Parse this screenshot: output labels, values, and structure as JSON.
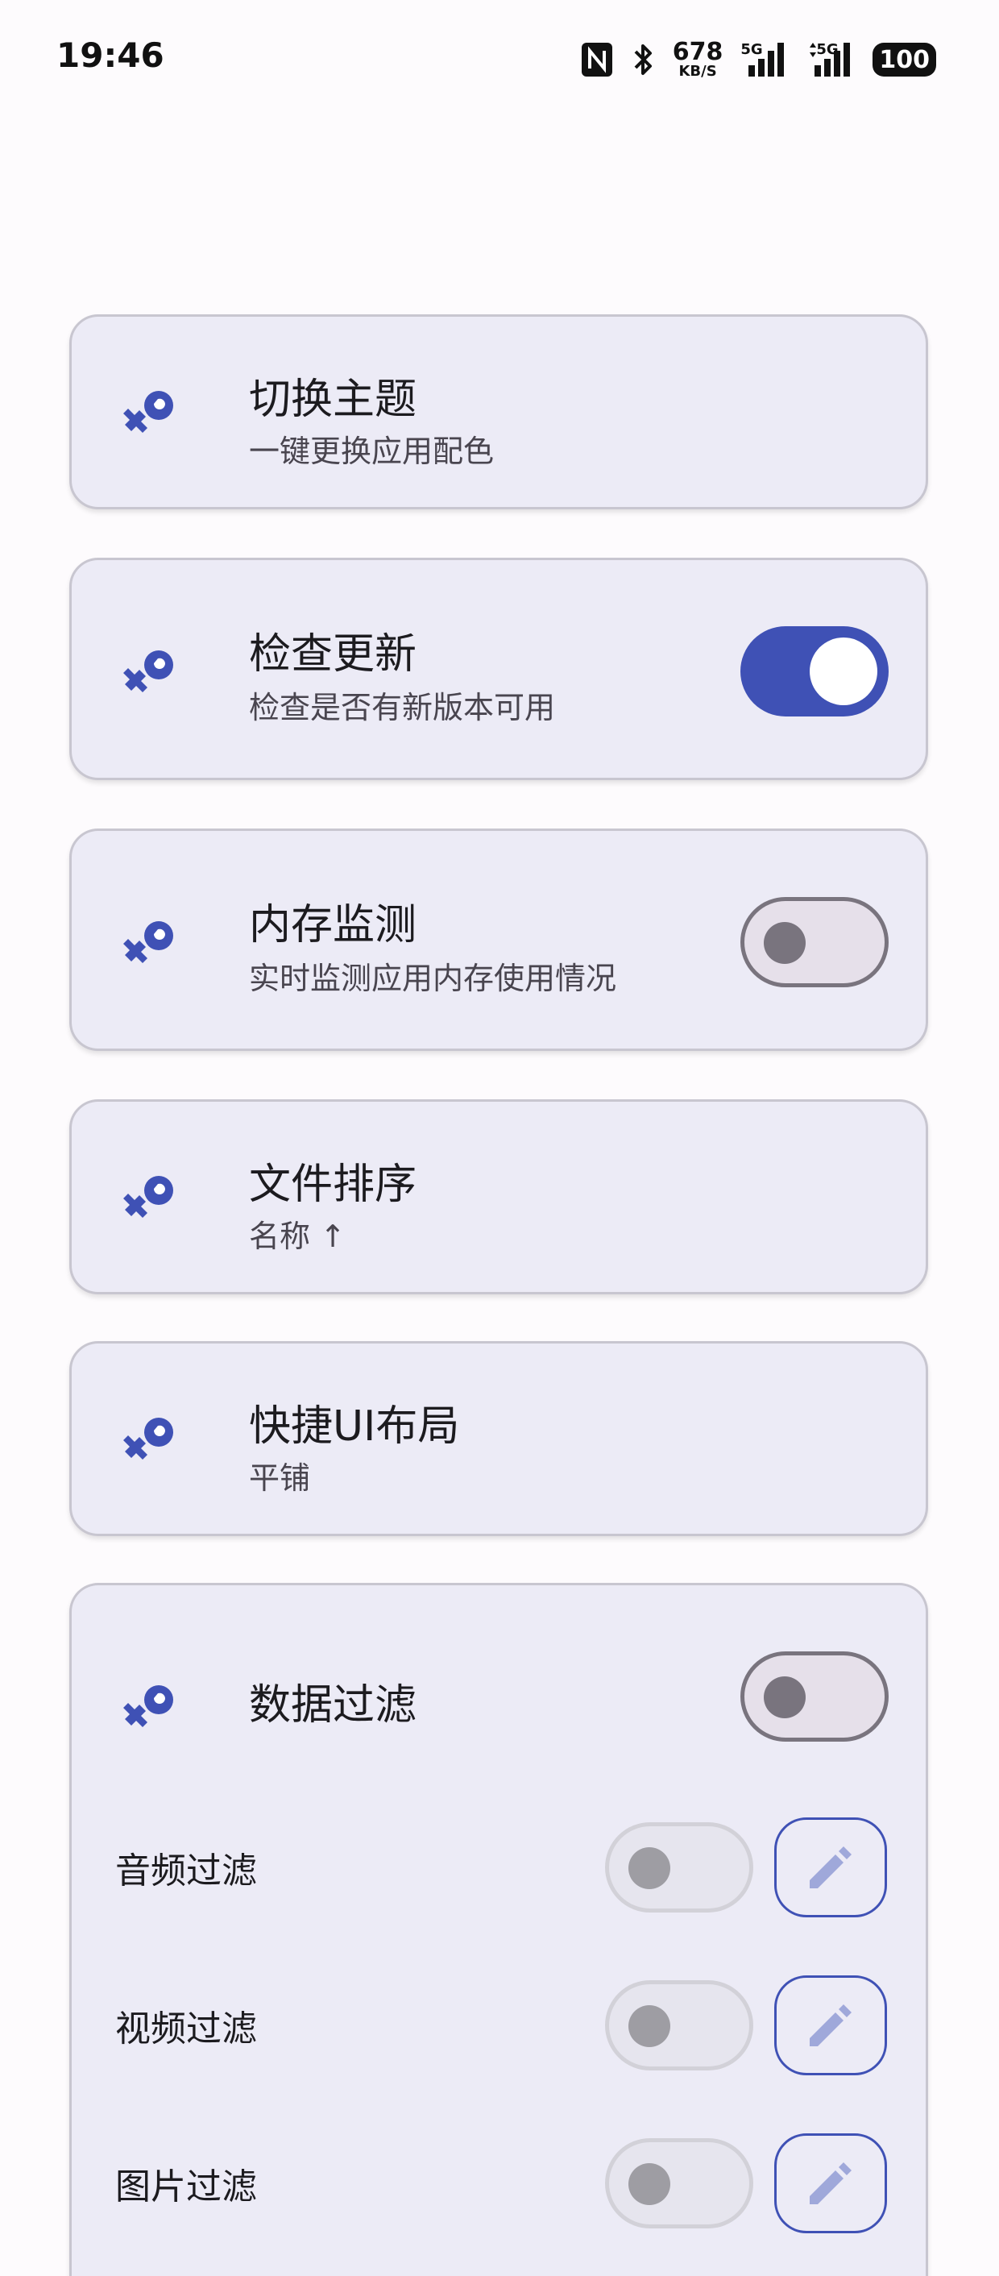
{
  "status_bar": {
    "time": "19:46",
    "net_speed": "678",
    "net_speed_unit": "KB/S",
    "signal1_label": "5G",
    "signal2_label": "5G",
    "battery": "100",
    "icons": [
      "nfc-icon",
      "bluetooth-icon",
      "signal-icon",
      "battery-icon"
    ]
  },
  "settings": [
    {
      "title": "切换主题",
      "subtitle": "一键更换应用配色"
    },
    {
      "title": "检查更新",
      "subtitle": "检查是否有新版本可用",
      "switch": "on"
    },
    {
      "title": "内存监测",
      "subtitle": "实时监测应用内存使用情况",
      "switch": "off"
    },
    {
      "title": "文件排序",
      "subtitle": "名称 ↑"
    },
    {
      "title": "快捷UI布局",
      "subtitle": "平铺"
    }
  ],
  "data_filter": {
    "title": "数据过滤",
    "switch": "off",
    "items": [
      {
        "label": "音频过滤",
        "switch": "disabled-off"
      },
      {
        "label": "视频过滤",
        "switch": "disabled-off"
      },
      {
        "label": "图片过滤",
        "switch": "disabled-off"
      }
    ]
  },
  "colors": {
    "accent": "#3f51b5",
    "card_bg": "#ecebf6",
    "card_border": "#c8c6d0",
    "icon": "#3f51b5",
    "edit_icon": "#9fa8da"
  },
  "icon_names": {
    "setting": "wrench-gear-icon",
    "edit": "pencil-icon"
  }
}
